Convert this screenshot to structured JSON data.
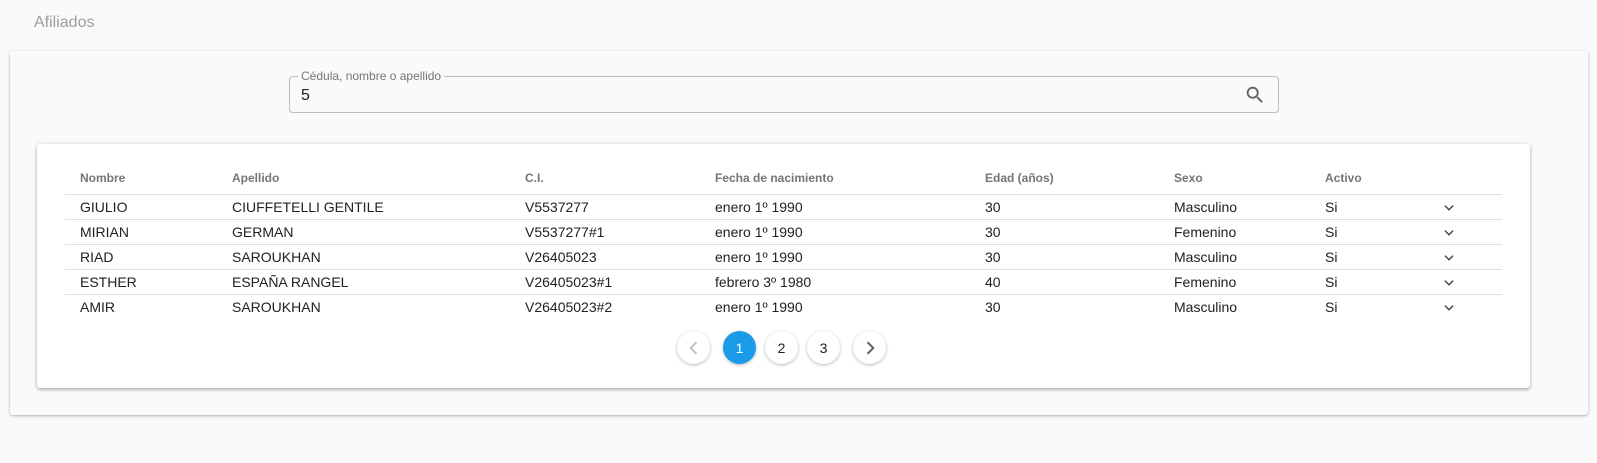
{
  "page": {
    "title": "Afiliados"
  },
  "search": {
    "label": "Cédula, nombre o apellido",
    "value": "5"
  },
  "table": {
    "headers": [
      "Nombre",
      "Apellido",
      "C.I.",
      "Fecha de nacimiento",
      "Edad (años)",
      "Sexo",
      "Activo"
    ],
    "rows": [
      [
        "GIULIO",
        "CIUFFETELLI GENTILE",
        "V5537277",
        "enero 1º 1990",
        "30",
        "Masculino",
        "Si"
      ],
      [
        "MIRIAN",
        "GERMAN",
        "V5537277#1",
        "enero 1º 1990",
        "30",
        "Femenino",
        "Si"
      ],
      [
        "RIAD",
        "SAROUKHAN",
        "V26405023",
        "enero 1º 1990",
        "30",
        "Masculino",
        "Si"
      ],
      [
        "ESTHER",
        "ESPAÑA RANGEL",
        "V26405023#1",
        "febrero 3º 1980",
        "40",
        "Femenino",
        "Si"
      ],
      [
        "AMIR",
        "SAROUKHAN",
        "V26405023#2",
        "enero 1º 1990",
        "30",
        "Masculino",
        "Si"
      ]
    ]
  },
  "pagination": {
    "pages": [
      "1",
      "2",
      "3"
    ],
    "current": "1",
    "accent": "#1a9be8",
    "prev_icon": "chevron-left-icon",
    "next_icon": "chevron-right-icon"
  },
  "icons": {
    "search": "search-icon",
    "expand": "chevron-down-icon"
  }
}
